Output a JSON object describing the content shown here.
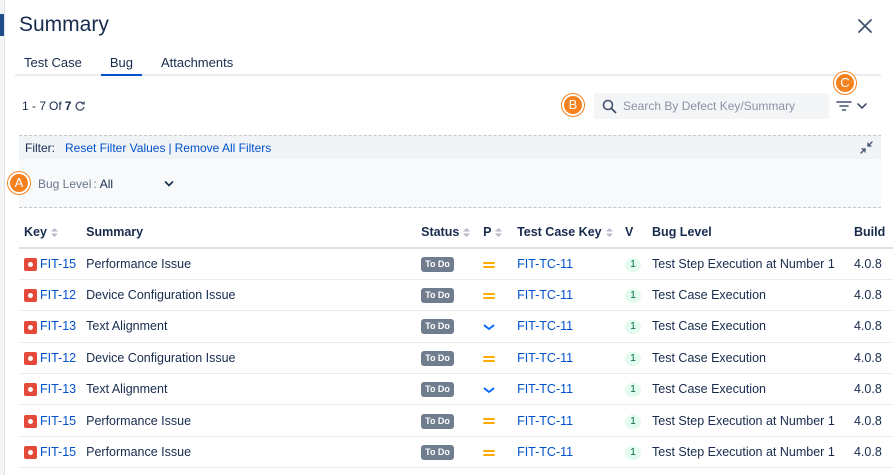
{
  "dialog": {
    "title": "Summary"
  },
  "tabs": [
    {
      "label": "Test Case",
      "active": false
    },
    {
      "label": "Bug",
      "active": true
    },
    {
      "label": "Attachments",
      "active": false
    }
  ],
  "pagination": {
    "range": "1 - 7",
    "of_label": "Of",
    "total": "7"
  },
  "markers": {
    "a": "A",
    "b": "B",
    "c": "C"
  },
  "search": {
    "placeholder": "Search By Defect Key/Summary",
    "value": ""
  },
  "filter": {
    "label": "Filter:",
    "reset_link": "Reset Filter Values",
    "separator": "|",
    "remove_link": "Remove All Filters",
    "bug_level_label": "Bug Level",
    "bug_level_value": "All"
  },
  "table": {
    "columns": [
      "Key",
      "Summary",
      "Status",
      "P",
      "Test Case Key",
      "V",
      "Bug Level",
      "Build"
    ],
    "rows": [
      {
        "key": "FIT-15",
        "summary": "Performance Issue",
        "status": "To Do",
        "priority": "medium",
        "test_case_key": "FIT-TC-11",
        "version": "1",
        "bug_level": "Test Step Execution at Number 1",
        "build": "4.0.8"
      },
      {
        "key": "FIT-12",
        "summary": "Device Configuration Issue",
        "status": "To Do",
        "priority": "medium",
        "test_case_key": "FIT-TC-11",
        "version": "1",
        "bug_level": "Test Case Execution",
        "build": "4.0.8"
      },
      {
        "key": "FIT-13",
        "summary": "Text Alignment",
        "status": "To Do",
        "priority": "low",
        "test_case_key": "FIT-TC-11",
        "version": "1",
        "bug_level": "Test Case Execution",
        "build": "4.0.8"
      },
      {
        "key": "FIT-12",
        "summary": "Device Configuration Issue",
        "status": "To Do",
        "priority": "medium",
        "test_case_key": "FIT-TC-11",
        "version": "1",
        "bug_level": "Test Case Execution",
        "build": "4.0.8"
      },
      {
        "key": "FIT-13",
        "summary": "Text Alignment",
        "status": "To Do",
        "priority": "low",
        "test_case_key": "FIT-TC-11",
        "version": "1",
        "bug_level": "Test Case Execution",
        "build": "4.0.8"
      },
      {
        "key": "FIT-15",
        "summary": "Performance Issue",
        "status": "To Do",
        "priority": "medium",
        "test_case_key": "FIT-TC-11",
        "version": "1",
        "bug_level": "Test Step Execution at Number 1",
        "build": "4.0.8"
      },
      {
        "key": "FIT-15",
        "summary": "Performance Issue",
        "status": "To Do",
        "priority": "medium",
        "test_case_key": "FIT-TC-11",
        "version": "1",
        "bug_level": "Test Step Execution at Number 1",
        "build": "4.0.8"
      }
    ]
  },
  "colors": {
    "accent": "#0052cc",
    "marker": "#f5821f",
    "bug_icon": "#e5493a",
    "status_badge": "#707d8e",
    "priority_medium": "#ffab00",
    "priority_low": "#0065ff"
  }
}
